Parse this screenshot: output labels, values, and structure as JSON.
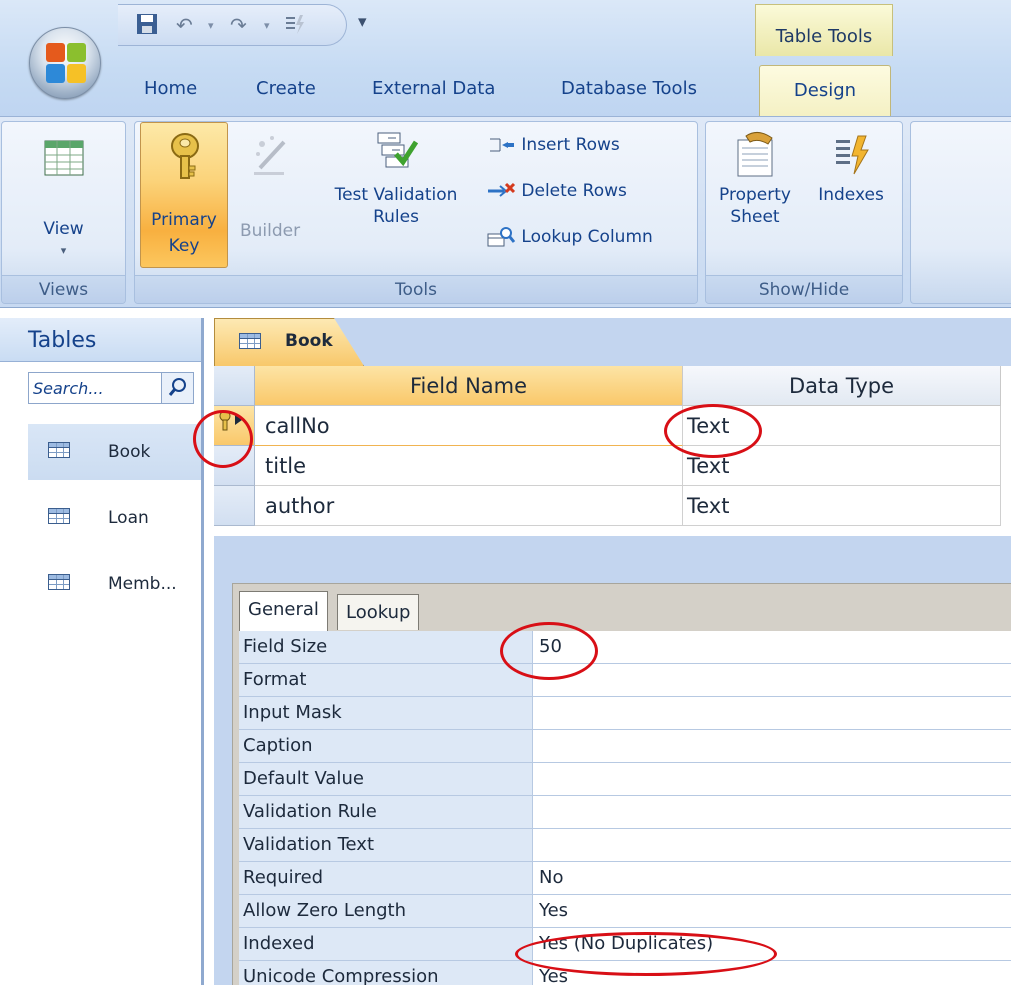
{
  "qat": {
    "save_icon": "save-icon",
    "undo_icon": "undo-icon",
    "redo_icon": "redo-icon",
    "customize_icon": "customize-qat-icon"
  },
  "context_tab": {
    "title": "Table Tools"
  },
  "tabs": {
    "home": "Home",
    "create": "Create",
    "external": "External Data",
    "dbtools": "Database Tools",
    "design": "Design"
  },
  "ribbon": {
    "views": {
      "label": "Views",
      "view": "View",
      "view_arrow": "▾"
    },
    "tools": {
      "label": "Tools",
      "primary_key_1": "Primary",
      "primary_key_2": "Key",
      "builder": "Builder",
      "test_validation_1": "Test Validation",
      "test_validation_2": "Rules",
      "insert_rows": "Insert Rows",
      "delete_rows": "Delete Rows",
      "lookup_column": "Lookup Column"
    },
    "showhide": {
      "label": "Show/Hide",
      "property_1": "Property",
      "property_2": "Sheet",
      "indexes": "Indexes"
    }
  },
  "nav": {
    "title": "Tables",
    "search_placeholder": "Search...",
    "items": [
      {
        "label": "Book"
      },
      {
        "label": "Loan"
      },
      {
        "label": "Memb..."
      }
    ]
  },
  "doc": {
    "tab_label": "Book",
    "columns": {
      "field_name": "Field Name",
      "data_type": "Data Type"
    },
    "rows": [
      {
        "field": "callNo",
        "type": "Text"
      },
      {
        "field": "title",
        "type": "Text"
      },
      {
        "field": "author",
        "type": "Text"
      }
    ]
  },
  "props": {
    "tabs": {
      "general": "General",
      "lookup": "Lookup"
    },
    "rows": [
      {
        "label": "Field Size",
        "value": "50"
      },
      {
        "label": "Format",
        "value": ""
      },
      {
        "label": "Input Mask",
        "value": ""
      },
      {
        "label": "Caption",
        "value": ""
      },
      {
        "label": "Default Value",
        "value": ""
      },
      {
        "label": "Validation Rule",
        "value": ""
      },
      {
        "label": "Validation Text",
        "value": ""
      },
      {
        "label": "Required",
        "value": "No"
      },
      {
        "label": "Allow Zero Length",
        "value": "Yes"
      },
      {
        "label": "Indexed",
        "value": "Yes (No Duplicates)"
      },
      {
        "label": "Unicode Compression",
        "value": "Yes"
      }
    ]
  },
  "colors": {
    "annotation": "#d80f16",
    "ribbon_bg": "#c7d9f1",
    "selected_orange": "#f8b040"
  }
}
